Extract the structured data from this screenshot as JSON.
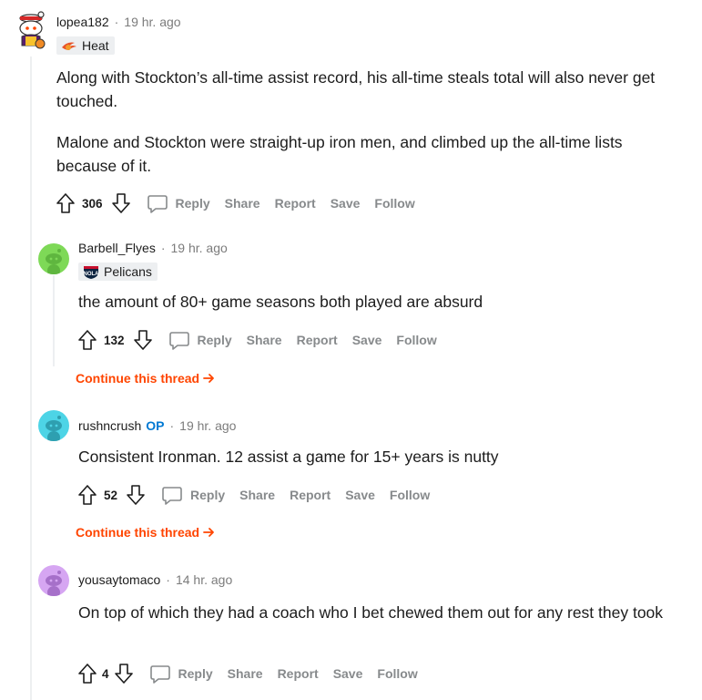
{
  "comments": [
    {
      "username": "lopea182",
      "time": "19 hr. ago",
      "flair": "Heat",
      "paragraphs": [
        "Along with Stockton’s all-time assist record, his all-time steals total will also never get touched.",
        "Malone and Stockton were straight-up iron men, and climbed up the all-time lists because of it."
      ],
      "score": "306"
    },
    {
      "username": "Barbell_Flyes",
      "time": "19 hr. ago",
      "flair": "Pelicans",
      "paragraphs": [
        "the amount of 80+ game seasons both played are absurd"
      ],
      "score": "132",
      "continue": "Continue this thread"
    },
    {
      "username": "rushncrush",
      "op_badge": "OP",
      "time": "19 hr. ago",
      "paragraphs": [
        "Consistent Ironman. 12 assist a game for 15+ years is nutty"
      ],
      "score": "52",
      "continue": "Continue this thread"
    },
    {
      "username": "yousaytomaco",
      "time": "14 hr. ago",
      "paragraphs": [
        "On top of which they had a coach who I bet chewed them out for any rest they took"
      ],
      "score": "4"
    }
  ],
  "actions": {
    "reply": "Reply",
    "share": "Share",
    "report": "Report",
    "save": "Save",
    "follow": "Follow"
  },
  "separator": "·",
  "colors": {
    "accent": "#ff4500",
    "op": "#0079d3",
    "meta": "#7c7c7c",
    "action": "#878a8c",
    "avatar_green": "#7ed957",
    "avatar_teal": "#4dd4e6",
    "avatar_lilac": "#d6a6f2"
  },
  "icons": [
    "upvote-icon",
    "downvote-icon",
    "comment-reply-icon",
    "heat-flair-icon",
    "pelicans-flair-icon",
    "arrow-right-icon",
    "snoo-avatar-icon"
  ]
}
